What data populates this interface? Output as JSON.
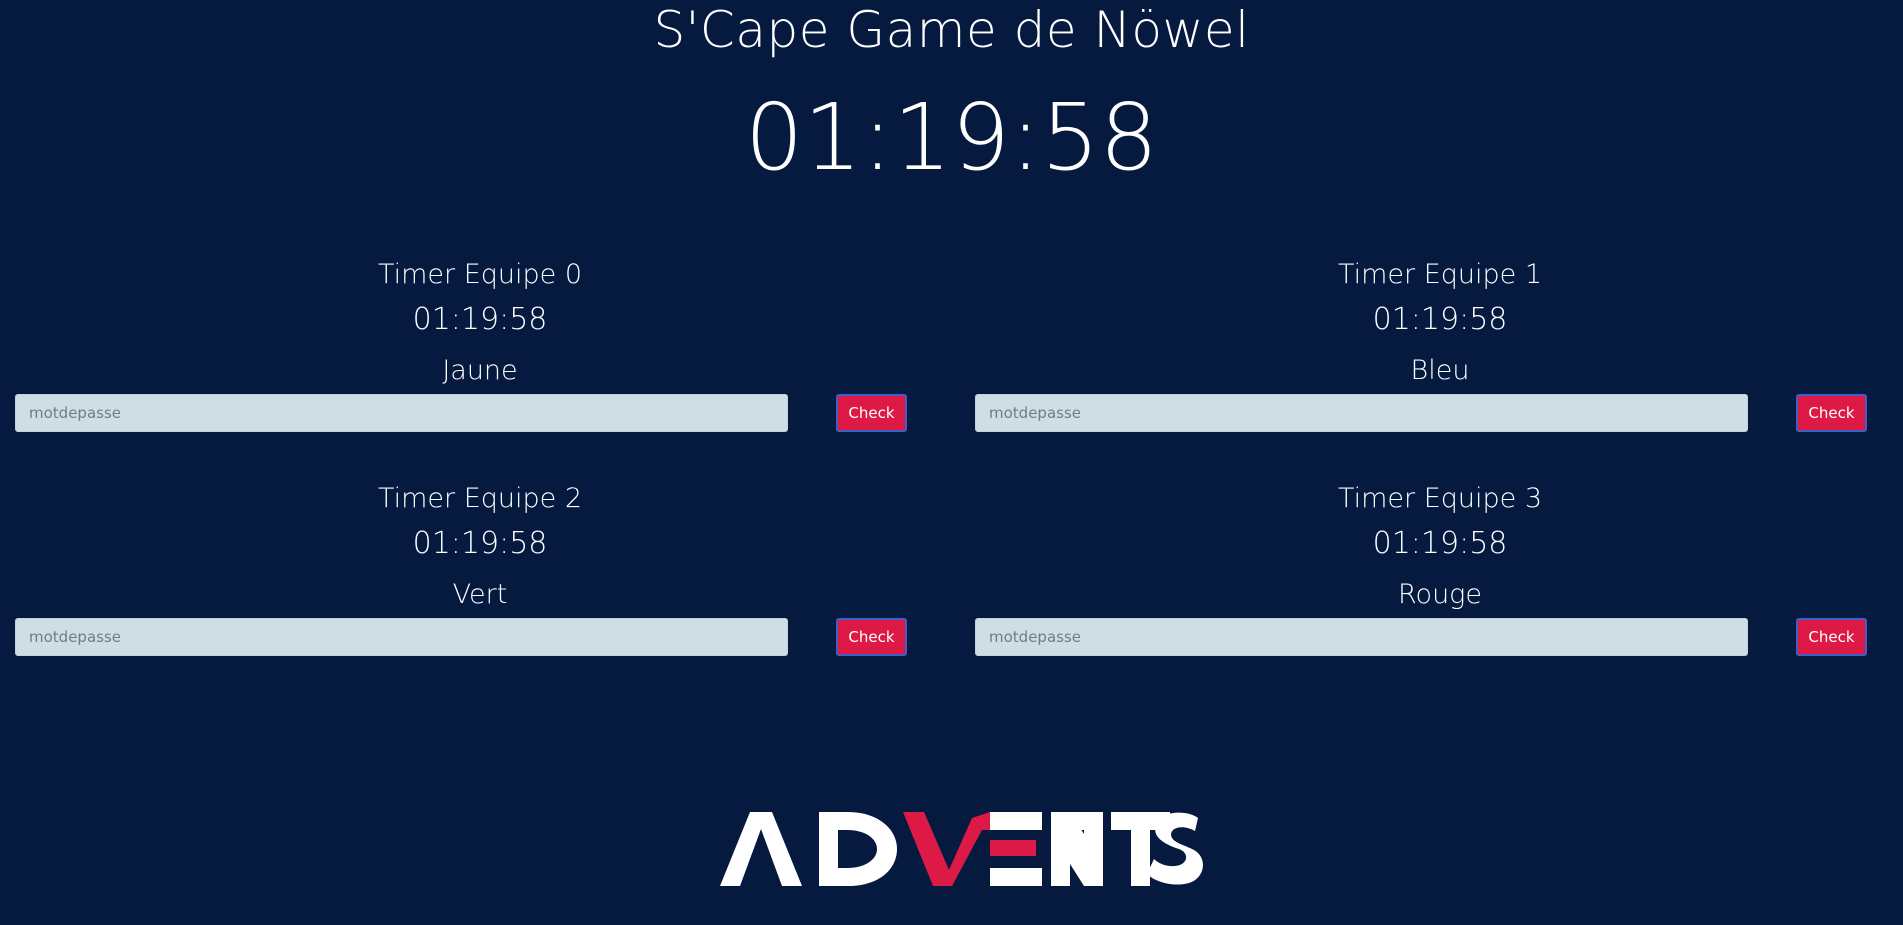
{
  "header": {
    "title": "S'Cape Game de Nöwel",
    "main_timer": "01:19:58"
  },
  "teams": [
    {
      "title": "Timer Equipe 0",
      "timer": "01:19:58",
      "color_name": "Jaune",
      "password_placeholder": "motdepasse",
      "password_value": "",
      "check_label": "Check"
    },
    {
      "title": "Timer Equipe 1",
      "timer": "01:19:58",
      "color_name": "Bleu",
      "password_placeholder": "motdepasse",
      "password_value": "",
      "check_label": "Check"
    },
    {
      "title": "Timer Equipe 2",
      "timer": "01:19:58",
      "color_name": "Vert",
      "password_placeholder": "motdepasse",
      "password_value": "",
      "check_label": "Check"
    },
    {
      "title": "Timer Equipe 3",
      "timer": "01:19:58",
      "color_name": "Rouge",
      "password_placeholder": "motdepasse",
      "password_value": "",
      "check_label": "Check"
    }
  ],
  "footer": {
    "logo_text": "ADVENTS",
    "logo_icon": "advents-logo",
    "brand_accent_color": "#dc1a45"
  },
  "colors": {
    "background": "#061a40",
    "input_background": "#cfdde5",
    "button_background": "#dc1a45",
    "button_border": "#3f5fc7",
    "text": "#ffffff"
  }
}
